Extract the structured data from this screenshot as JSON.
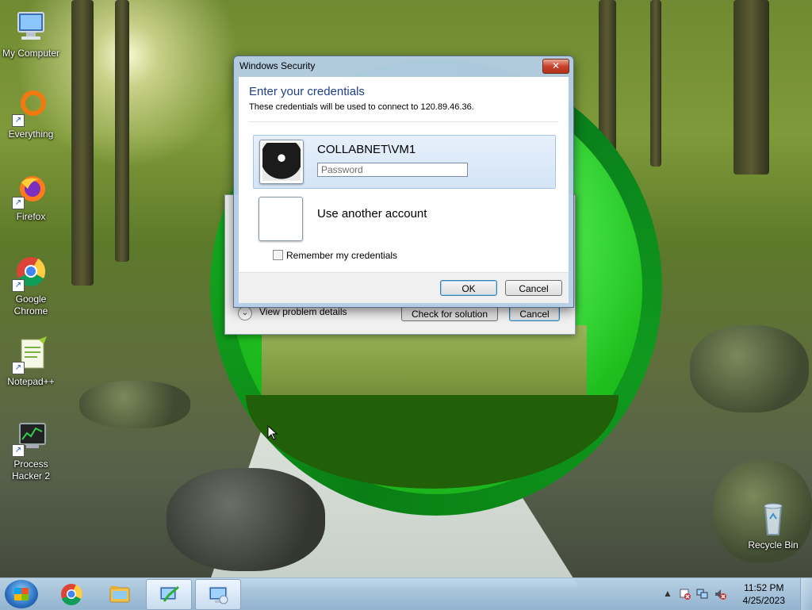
{
  "desktop": {
    "icons": [
      {
        "label": "My Computer"
      },
      {
        "label": "Everything"
      },
      {
        "label": "Firefox"
      },
      {
        "label": "Google Chrome"
      },
      {
        "label": "Notepad++"
      },
      {
        "label": "Process Hacker 2"
      },
      {
        "label": "Recycle Bin"
      }
    ]
  },
  "background_dialog": {
    "details_label": "View problem details",
    "check_solution_button": "Check for solution",
    "cancel_button": "Cancel"
  },
  "security_dialog": {
    "title": "Windows Security",
    "close_glyph": "✕",
    "heading": "Enter your credentials",
    "subtext": "These credentials will be used to connect to 120.89.46.36.",
    "account_user": "COLLABNET\\VM1",
    "password_placeholder": "Password",
    "password_value": "",
    "other_account_label": "Use another account",
    "remember_label": "Remember my credentials",
    "remember_checked": false,
    "ok_button": "OK",
    "cancel_button": "Cancel"
  },
  "taskbar": {
    "pinned": [
      "start-button",
      "chrome",
      "file-explorer",
      "notepad-app",
      "remote-desktop"
    ],
    "clock_time": "11:52 PM",
    "clock_date": "4/25/2023",
    "tray_icons": [
      "show-hidden-icons",
      "action-center-icon",
      "network-icon",
      "volume-muted-icon"
    ]
  },
  "colors": {
    "dialog_heading": "#1e3f8a",
    "ring_green": "#13a81f",
    "close_red": "#c7432c"
  }
}
